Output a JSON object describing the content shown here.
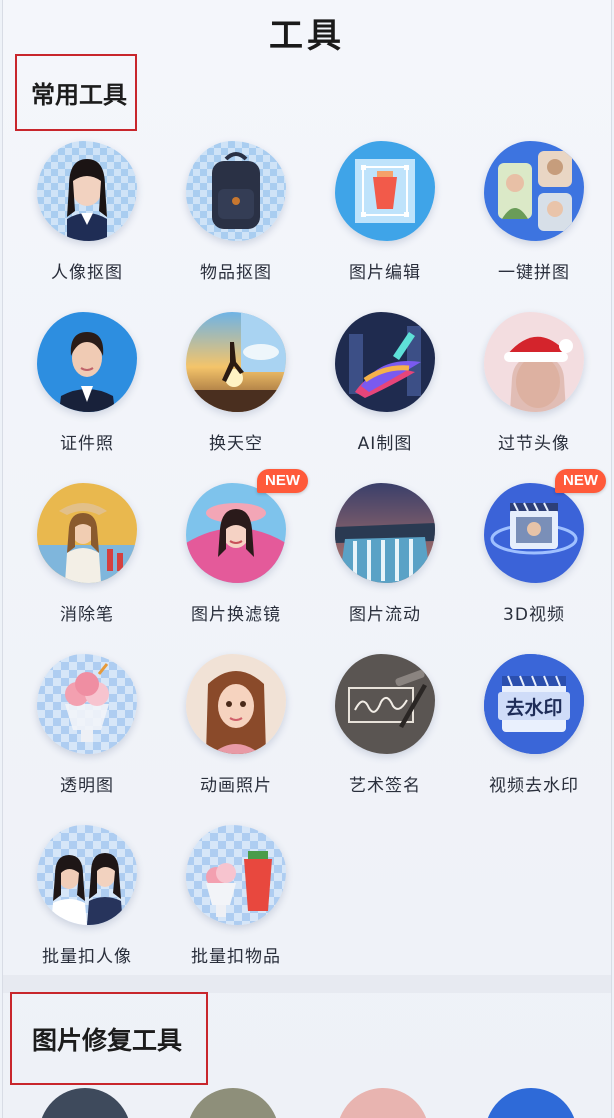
{
  "page": {
    "title": "工具"
  },
  "sections": {
    "common": {
      "title": "常用工具"
    },
    "repair": {
      "title": "图片修复工具"
    }
  },
  "tools": [
    {
      "label": "人像抠图",
      "icon": "portrait-cutout-icon"
    },
    {
      "label": "物品抠图",
      "icon": "object-cutout-icon"
    },
    {
      "label": "图片编辑",
      "icon": "image-edit-icon"
    },
    {
      "label": "一键拼图",
      "icon": "collage-icon"
    },
    {
      "label": "证件照",
      "icon": "id-photo-icon"
    },
    {
      "label": "换天空",
      "icon": "sky-replace-icon"
    },
    {
      "label": "AI制图",
      "icon": "ai-drawing-icon"
    },
    {
      "label": "过节头像",
      "icon": "holiday-avatar-icon"
    },
    {
      "label": "消除笔",
      "icon": "eraser-pen-icon"
    },
    {
      "label": "图片换滤镜",
      "icon": "filter-icon",
      "badge": "NEW"
    },
    {
      "label": "图片流动",
      "icon": "image-flow-icon"
    },
    {
      "label": "3D视频",
      "icon": "3d-video-icon",
      "badge": "NEW"
    },
    {
      "label": "透明图",
      "icon": "transparent-image-icon"
    },
    {
      "label": "动画照片",
      "icon": "animated-photo-icon"
    },
    {
      "label": "艺术签名",
      "icon": "art-signature-icon"
    },
    {
      "label": "视频去水印",
      "icon": "video-watermark-remove-icon",
      "icon_text": "去水印"
    },
    {
      "label": "批量扣人像",
      "icon": "batch-portrait-cutout-icon"
    },
    {
      "label": "批量扣物品",
      "icon": "batch-object-cutout-icon"
    }
  ]
}
